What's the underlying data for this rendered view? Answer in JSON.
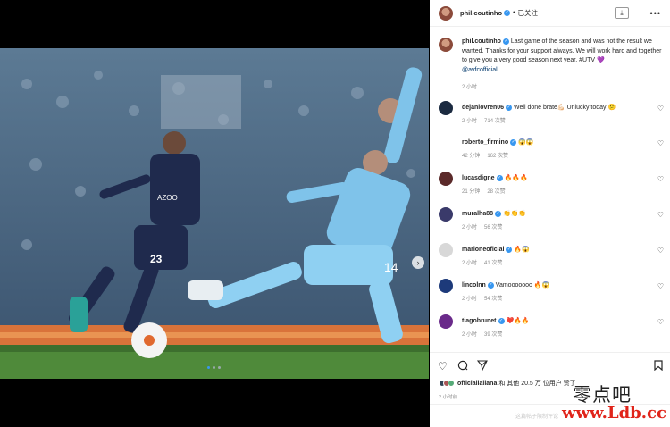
{
  "header": {
    "username": "phil.coutinho",
    "separator": "•",
    "follow_label": "已关注",
    "download_icon": "download-icon",
    "more_label": "•••"
  },
  "caption": {
    "username": "phil.coutinho",
    "text_1": "Last game of the season and was not the result we wanted. Thanks for your support always. We will work hard and together to give you a very good season next year. #UTV 💜",
    "mention": "@avfcofficial",
    "time": "2 小时"
  },
  "comments": [
    {
      "user": "dejanlovren06",
      "text": "Well done brate💪🏻 Unlucky today 😕",
      "time": "2 小时",
      "likes": "714 次赞"
    },
    {
      "user": "roberto_firmino",
      "text": "😱😱",
      "time": "42 分钟",
      "likes": "162 次赞"
    },
    {
      "user": "lucasdigne",
      "text": "🔥🔥🔥",
      "time": "21 分钟",
      "likes": "28 次赞"
    },
    {
      "user": "muralha88",
      "text": "👏👏👏",
      "time": "2 小时",
      "likes": "56 次赞"
    },
    {
      "user": "marloneoficial",
      "text": "🔥😱",
      "time": "2 小时",
      "likes": "41 次赞"
    },
    {
      "user": "lincolnn",
      "text": "Vamooooooo 🔥😱",
      "time": "2 小时",
      "likes": "54 次赞"
    },
    {
      "user": "tiagobrunet",
      "text": "❤️🔥🔥",
      "time": "2 小时",
      "likes": "39 次赞"
    }
  ],
  "likes": {
    "user": "officiallallana",
    "rest": "和 其他 20.5 万 位用户 赞了"
  },
  "post_time": "2 小时前",
  "add_comment_placeholder": "这篇帖子限制评论",
  "watermark": {
    "line1": "零点吧",
    "line2": "www.Ldb.cc"
  },
  "colors": {
    "accent": "#3897f0",
    "city_blue": "#7fc3ea",
    "villa_navy": "#1f2a4d",
    "grass": "#4f8a3a"
  }
}
